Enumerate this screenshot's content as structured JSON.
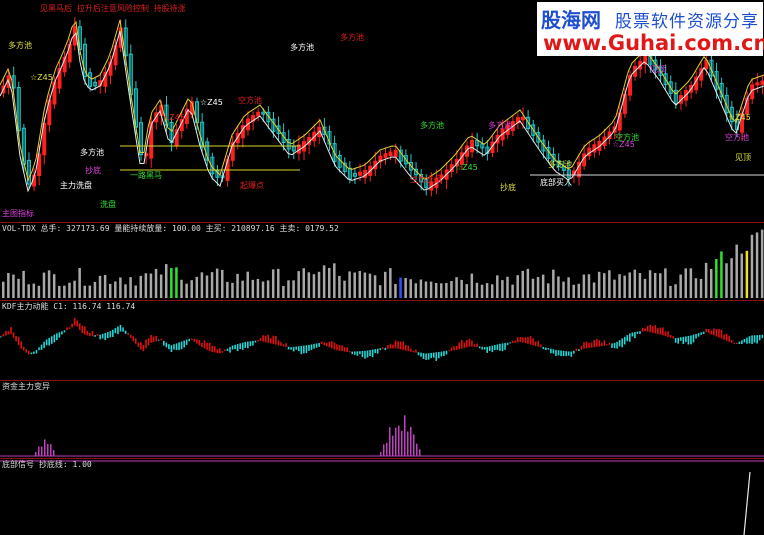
{
  "colors": {
    "bg": "#000000",
    "up": "#ff2020",
    "down": "#22c8c8",
    "sep": "#8a1010",
    "vol": "#a8a8a8",
    "force_up": "#e01010",
    "force_dn": "#20d8d8",
    "change": "#c040c0"
  },
  "watermark": {
    "logo_cn": "股海网",
    "slogan": "股票软件资源分享",
    "url": "www.Guhai.com.cn"
  },
  "header_text": "见黑马后 拉升后注意风险控制 持股待涨",
  "price_labels": [
    "多方池",
    "多方池",
    "多方池",
    "多方池",
    "多方池",
    "多方池",
    "多方池",
    "空方池",
    "空方池",
    "空方池",
    "☆Z45",
    "☆Z45",
    "☆Z45",
    "☆Z45",
    "☆Z45",
    "☆Z45",
    "主力洗盘",
    "主力洗盘",
    "洗盘",
    "抄底",
    "抄底",
    "底部买入",
    "起爆点",
    "一路黑马",
    "见顶",
    "见顶"
  ],
  "panels": {
    "price": {
      "title": "主图指标"
    },
    "volume": {
      "title": "VOL-TDX 总手: 327173.69  量能持续放量: 100.00  主买: 210897.16  主卖: 0179.52"
    },
    "force": {
      "title": "KDF主力动能  C1: 116.74   116.74"
    },
    "change": {
      "title": "资金主力变异"
    },
    "bottom": {
      "title": "底部信号  抄底线: 1.00"
    }
  },
  "chart_data": [
    {
      "type": "candlestick",
      "name": "price"
    },
    {
      "type": "bar",
      "name": "volume"
    },
    {
      "type": "bar",
      "name": "force"
    },
    {
      "type": "bar",
      "name": "change"
    },
    {
      "type": "line",
      "name": "bottom"
    }
  ]
}
